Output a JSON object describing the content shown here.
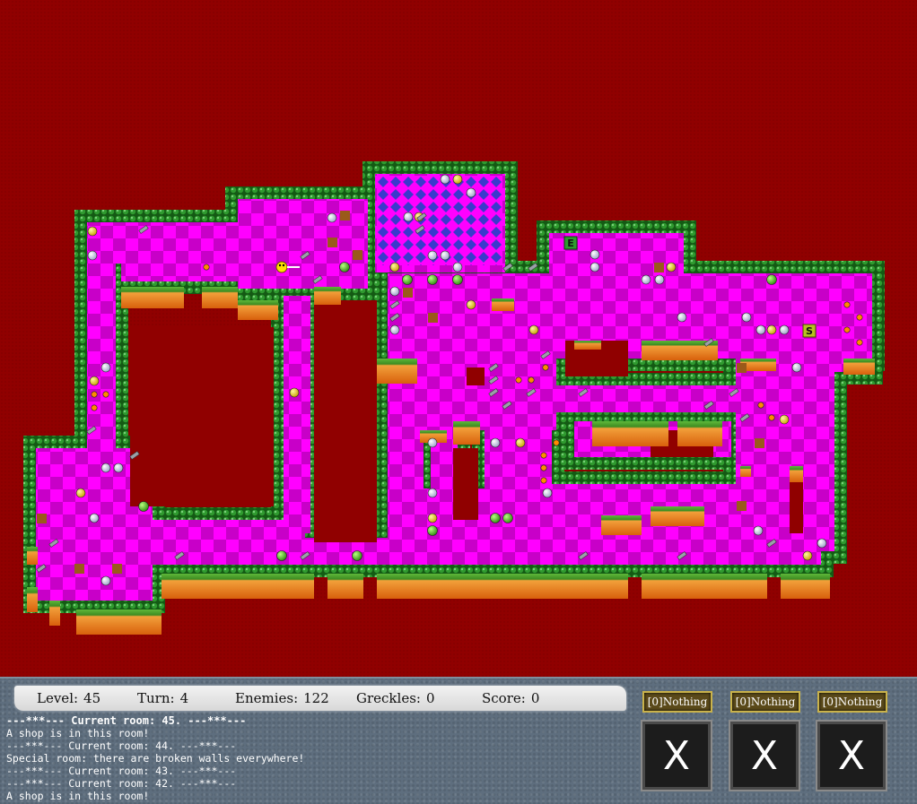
{
  "colors": {
    "background": "#900000",
    "floor_a": "#ff00ff",
    "floor_b": "#c800c8",
    "wall": "#1e7a1e",
    "ledge_grass": "#4aa82e",
    "ledge_dirt": "#e8821a",
    "hud": "#5e6e7e",
    "exit_tile": "#2f9a2f",
    "shop_tile": "#b8c020"
  },
  "map_tiles": {
    "exit_label": "E",
    "shop_label": "S"
  },
  "stats": {
    "level_label": "Level:",
    "level_value": "45",
    "turn_label": "Turn:",
    "turn_value": "4",
    "enemies_label": "Enemies:",
    "enemies_value": "122",
    "greckles_label": "Greckles:",
    "greckles_value": "0",
    "score_label": "Score:",
    "score_value": "0"
  },
  "log": [
    {
      "text": "---***--- Current room: 45. ---***---",
      "bold": true
    },
    {
      "text": "A shop is in this room!",
      "bold": false
    },
    {
      "text": "---***--- Current room: 44. ---***---",
      "bold": false
    },
    {
      "text": "Special room: there are broken walls everywhere!",
      "bold": false
    },
    {
      "text": "---***--- Current room: 43. ---***---",
      "bold": false
    },
    {
      "text": "---***--- Current room: 42. ---***---",
      "bold": false
    },
    {
      "text": "A shop is in this room!",
      "bold": false
    }
  ],
  "inventory": [
    {
      "label": "[0]Nothing",
      "mark": "X"
    },
    {
      "label": "[0]Nothing",
      "mark": "X"
    },
    {
      "label": "[0]Nothing",
      "mark": "X"
    }
  ]
}
